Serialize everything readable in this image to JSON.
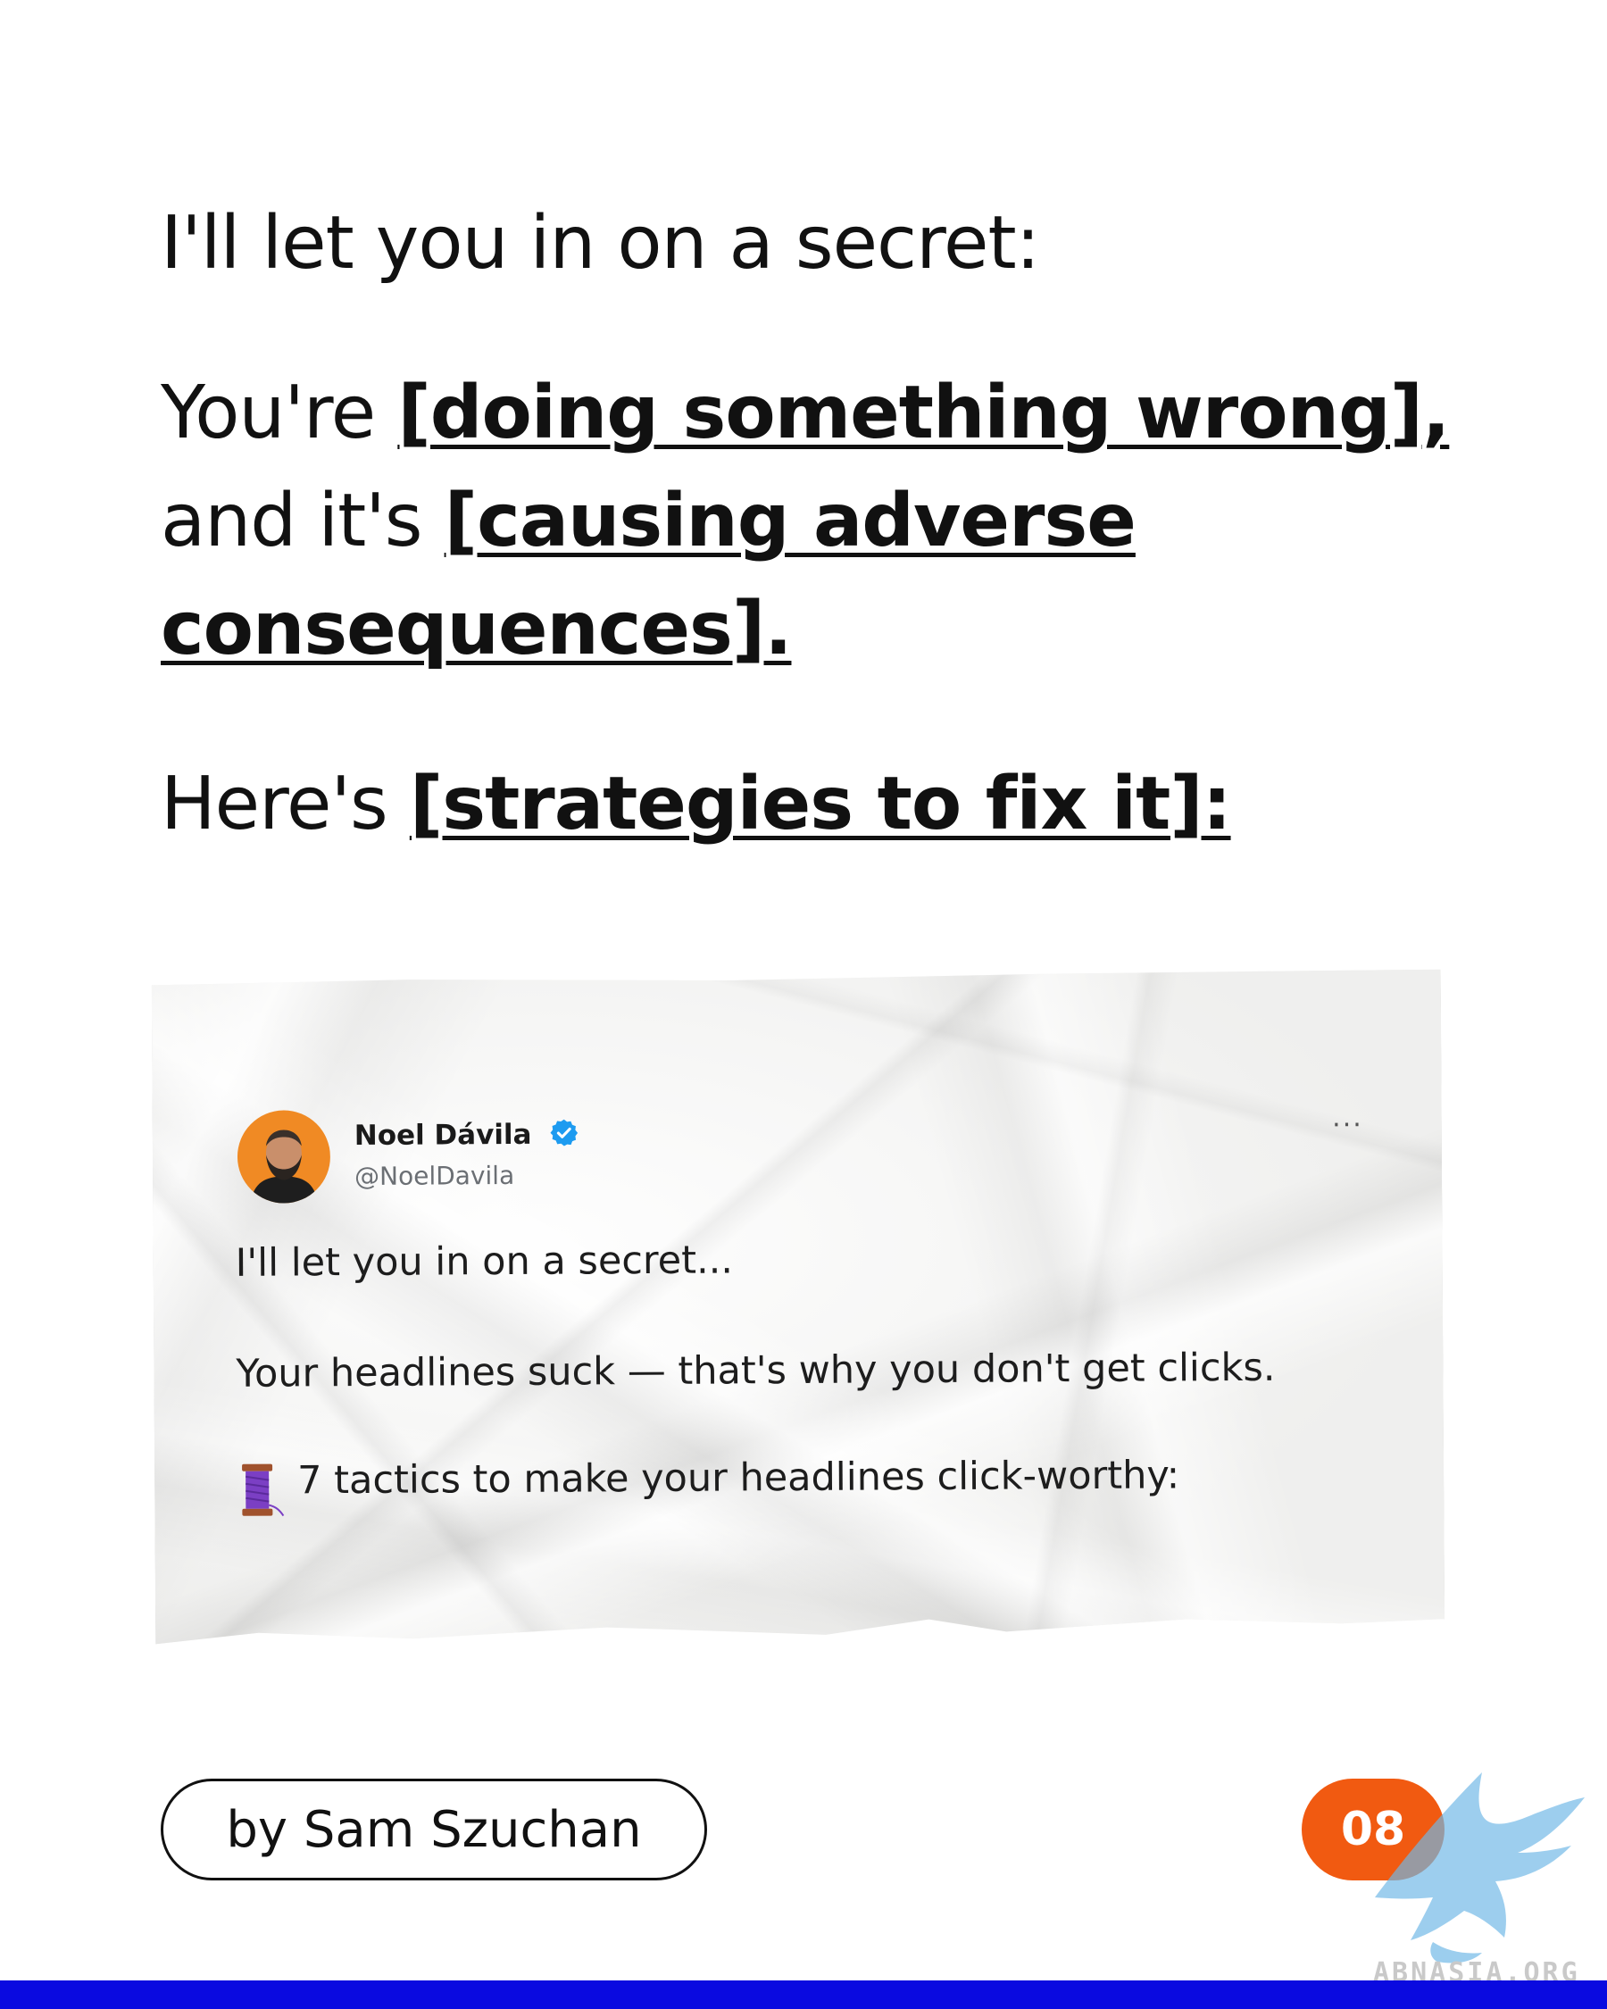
{
  "colors": {
    "text": "#111111",
    "badge": "#f15a11",
    "bottom_bar": "#0a0ae0",
    "verified": "#1d9bf0",
    "avatar_bg": "#f08a24"
  },
  "headline": {
    "line1": "I'll let you in on a secret:",
    "line2_plain": "You're ",
    "line2_emph": "[doing something wrong],",
    "line3_plain": "and it's ",
    "line3_emph": "[causing adverse",
    "line4_emph": "consequences].",
    "line5_plain": "Here's ",
    "line5_emph": "[strategies to fix it]:"
  },
  "tweet": {
    "name": "Noel Dávila",
    "handle": "@NoelDavila",
    "more": "...",
    "line1": "I'll let you in on a secret...",
    "line2": "Your headlines suck — that's why you don't get clicks.",
    "line3": "7 tactics to make your headlines click-worthy:",
    "icons": {
      "verified": "verified-badge-icon",
      "more": "more-options-icon",
      "thread": "thread-spool-icon"
    }
  },
  "footer": {
    "author": "by Sam Szuchan",
    "page": "08",
    "watermark": "ABNASIA.ORG"
  }
}
